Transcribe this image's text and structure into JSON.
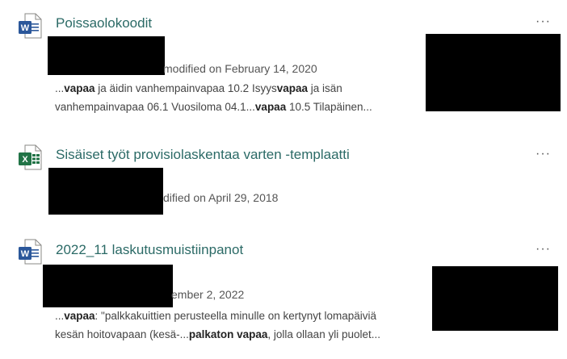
{
  "results": [
    {
      "title": "Poissaolokoodit",
      "file_icon": "word-icon",
      "meta": "modified on February 14, 2020",
      "snippet_line1": [
        {
          "t": "...",
          "b": false
        },
        {
          "t": "vapaa",
          "b": true
        },
        {
          "t": " ja äidin vanhempainvapaa 10.2 Isyys",
          "b": false
        },
        {
          "t": "vapaa",
          "b": true
        },
        {
          "t": " ja isän",
          "b": false
        }
      ],
      "snippet_line2": [
        {
          "t": "vanhempainvapaa 06.1 Vuosiloma 04.1...",
          "b": false
        },
        {
          "t": "vapaa",
          "b": true
        },
        {
          "t": " 10.5 Tilapäinen...",
          "b": false
        }
      ],
      "more_label": "···"
    },
    {
      "title": "Sisäiset työt provisiolaskentaa varten -templaatti",
      "file_icon": "excel-icon",
      "meta": "dified on April 29, 2018",
      "more_label": "···"
    },
    {
      "title": "2022_11 laskutusmuistiinpanot",
      "file_icon": "word-icon",
      "meta": "ember 2, 2022",
      "snippet_line1": [
        {
          "t": "...",
          "b": false
        },
        {
          "t": "vapaa",
          "b": true
        },
        {
          "t": ": \"palkkakuittien perusteella minulle on kertynyt lomapäiviä",
          "b": false
        }
      ],
      "snippet_line2": [
        {
          "t": "kesän hoitovapaan (kesä-...",
          "b": false
        },
        {
          "t": "palkaton vapaa",
          "b": true
        },
        {
          "t": ", jolla ollaan yli puolet...",
          "b": false
        }
      ],
      "more_label": "···"
    }
  ],
  "colors": {
    "title": "#2b6a66",
    "word_blue": "#2b579a",
    "excel_green": "#217346",
    "redaction": "#000000"
  }
}
